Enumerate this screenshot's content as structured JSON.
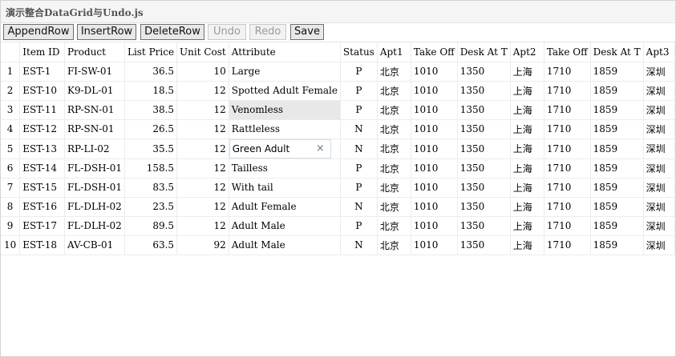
{
  "panel": {
    "title": "演示整合DataGrid与Undo.js"
  },
  "toolbar": {
    "buttons": [
      {
        "label": "AppendRow",
        "enabled": true
      },
      {
        "label": "InsertRow",
        "enabled": true
      },
      {
        "label": "DeleteRow",
        "enabled": true
      },
      {
        "label": "Undo",
        "enabled": false
      },
      {
        "label": "Redo",
        "enabled": false
      },
      {
        "label": "Save",
        "enabled": true
      }
    ]
  },
  "grid": {
    "columns": [
      "",
      "Item ID",
      "Product",
      "List Price",
      "Unit Cost",
      "Attribute",
      "Status",
      "Apt1",
      "Take Off",
      "Desk At T",
      "Apt2",
      "Take Off",
      "Desk At T",
      "Apt3"
    ],
    "rows": [
      {
        "n": "1",
        "itemid": "EST-1",
        "product": "FI-SW-01",
        "listprice": "36.5",
        "unitcost": "10",
        "attr": "Large",
        "status": "P",
        "apt1": "北京",
        "takeoff1": "1010",
        "desk1": "1350",
        "apt2": "上海",
        "takeoff2": "1710",
        "desk2": "1859",
        "apt3": "深圳"
      },
      {
        "n": "2",
        "itemid": "EST-10",
        "product": "K9-DL-01",
        "listprice": "18.5",
        "unitcost": "12",
        "attr": "Spotted Adult Female",
        "status": "P",
        "apt1": "北京",
        "takeoff1": "1010",
        "desk1": "1350",
        "apt2": "上海",
        "takeoff2": "1710",
        "desk2": "1859",
        "apt3": "深圳"
      },
      {
        "n": "3",
        "itemid": "EST-11",
        "product": "RP-SN-01",
        "listprice": "38.5",
        "unitcost": "12",
        "attr": "Venomless",
        "status": "P",
        "apt1": "北京",
        "takeoff1": "1010",
        "desk1": "1350",
        "apt2": "上海",
        "takeoff2": "1710",
        "desk2": "1859",
        "apt3": "深圳"
      },
      {
        "n": "4",
        "itemid": "EST-12",
        "product": "RP-SN-01",
        "listprice": "26.5",
        "unitcost": "12",
        "attr": "Rattleless",
        "status": "N",
        "apt1": "北京",
        "takeoff1": "1010",
        "desk1": "1350",
        "apt2": "上海",
        "takeoff2": "1710",
        "desk2": "1859",
        "apt3": "深圳"
      },
      {
        "n": "5",
        "itemid": "EST-13",
        "product": "RP-LI-02",
        "listprice": "35.5",
        "unitcost": "12",
        "attr": "Green Adult",
        "status": "N",
        "apt1": "北京",
        "takeoff1": "1010",
        "desk1": "1350",
        "apt2": "上海",
        "takeoff2": "1710",
        "desk2": "1859",
        "apt3": "深圳"
      },
      {
        "n": "6",
        "itemid": "EST-14",
        "product": "FL-DSH-01",
        "listprice": "158.5",
        "unitcost": "12",
        "attr": "Tailless",
        "status": "P",
        "apt1": "北京",
        "takeoff1": "1010",
        "desk1": "1350",
        "apt2": "上海",
        "takeoff2": "1710",
        "desk2": "1859",
        "apt3": "深圳"
      },
      {
        "n": "7",
        "itemid": "EST-15",
        "product": "FL-DSH-01",
        "listprice": "83.5",
        "unitcost": "12",
        "attr": "With tail",
        "status": "P",
        "apt1": "北京",
        "takeoff1": "1010",
        "desk1": "1350",
        "apt2": "上海",
        "takeoff2": "1710",
        "desk2": "1859",
        "apt3": "深圳"
      },
      {
        "n": "8",
        "itemid": "EST-16",
        "product": "FL-DLH-02",
        "listprice": "23.5",
        "unitcost": "12",
        "attr": "Adult Female",
        "status": "N",
        "apt1": "北京",
        "takeoff1": "1010",
        "desk1": "1350",
        "apt2": "上海",
        "takeoff2": "1710",
        "desk2": "1859",
        "apt3": "深圳"
      },
      {
        "n": "9",
        "itemid": "EST-17",
        "product": "FL-DLH-02",
        "listprice": "89.5",
        "unitcost": "12",
        "attr": "Adult Male",
        "status": "P",
        "apt1": "北京",
        "takeoff1": "1010",
        "desk1": "1350",
        "apt2": "上海",
        "takeoff2": "1710",
        "desk2": "1859",
        "apt3": "深圳"
      },
      {
        "n": "10",
        "itemid": "EST-18",
        "product": "AV-CB-01",
        "listprice": "63.5",
        "unitcost": "92",
        "attr": "Adult Male",
        "status": "N",
        "apt1": "北京",
        "takeoff1": "1010",
        "desk1": "1350",
        "apt2": "上海",
        "takeoff2": "1710",
        "desk2": "1859",
        "apt3": "深圳"
      }
    ],
    "selected_row": "3",
    "editing_row": "5",
    "editing_value": "Green Adult"
  },
  "icons": {
    "editor_clear": "close-icon"
  }
}
